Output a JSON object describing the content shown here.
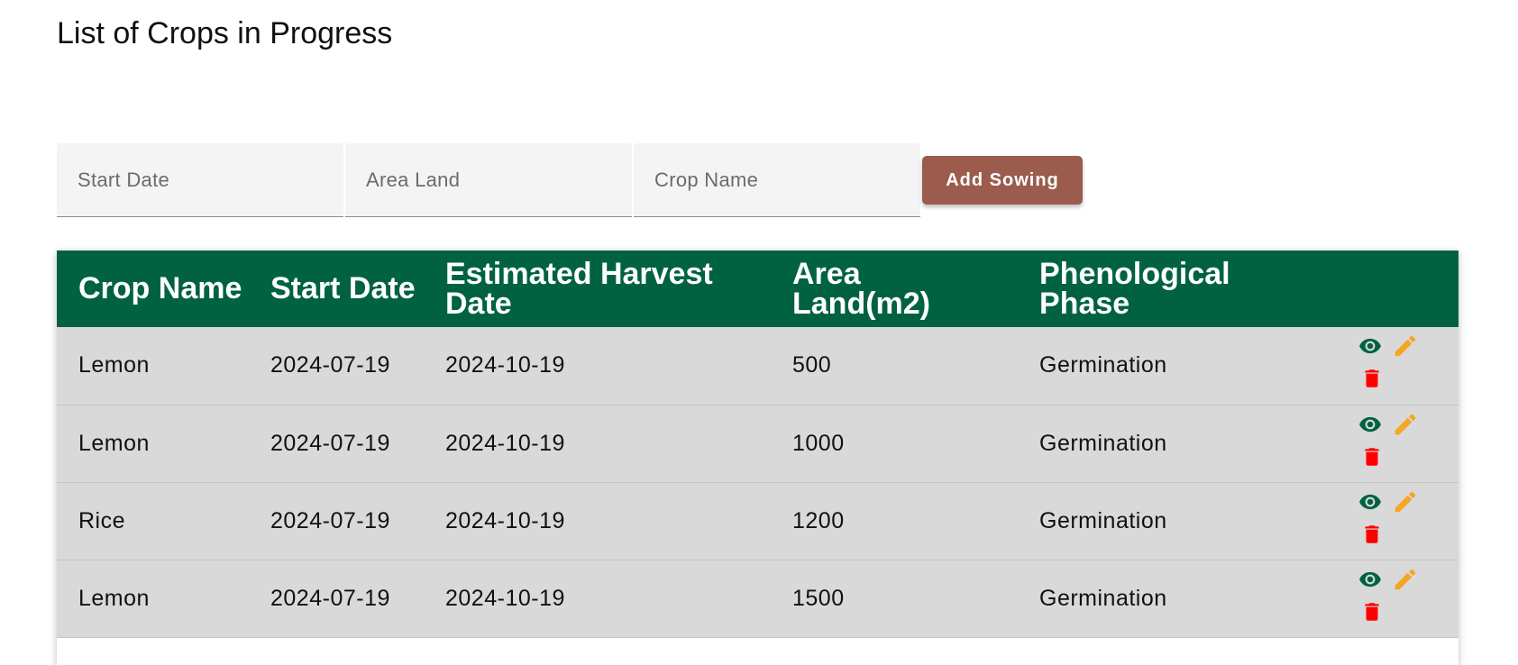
{
  "page": {
    "title": "List of Crops in Progress"
  },
  "form": {
    "start_date_placeholder": "Start Date",
    "area_land_placeholder": "Area Land",
    "crop_name_placeholder": "Crop Name",
    "add_button_label": "Add Sowing"
  },
  "table": {
    "headers": {
      "crop_name": "Crop Name",
      "start_date": "Start Date",
      "harvest_date": "Estimated Harvest Date",
      "area_land": "Area Land(m2)",
      "phase": "Phenological Phase"
    },
    "rows": [
      {
        "crop_name": "Lemon",
        "start_date": "2024-07-19",
        "harvest_date": "2024-10-19",
        "area_land": "500",
        "phase": "Germination"
      },
      {
        "crop_name": "Lemon",
        "start_date": "2024-07-19",
        "harvest_date": "2024-10-19",
        "area_land": "1000",
        "phase": "Germination"
      },
      {
        "crop_name": "Rice",
        "start_date": "2024-07-19",
        "harvest_date": "2024-10-19",
        "area_land": "1200",
        "phase": "Germination"
      },
      {
        "crop_name": "Lemon",
        "start_date": "2024-07-19",
        "harvest_date": "2024-10-19",
        "area_land": "1500",
        "phase": "Germination"
      }
    ],
    "row_actions": [
      "eye-icon",
      "pencil-icon",
      "trash-icon"
    ]
  },
  "colors": {
    "header_bg": "#006241",
    "row_bg": "#d9d9d9",
    "button_bg": "#9b5c4e",
    "view_icon": "#006241",
    "edit_icon": "#f5a623",
    "delete_icon": "#ff0000"
  }
}
